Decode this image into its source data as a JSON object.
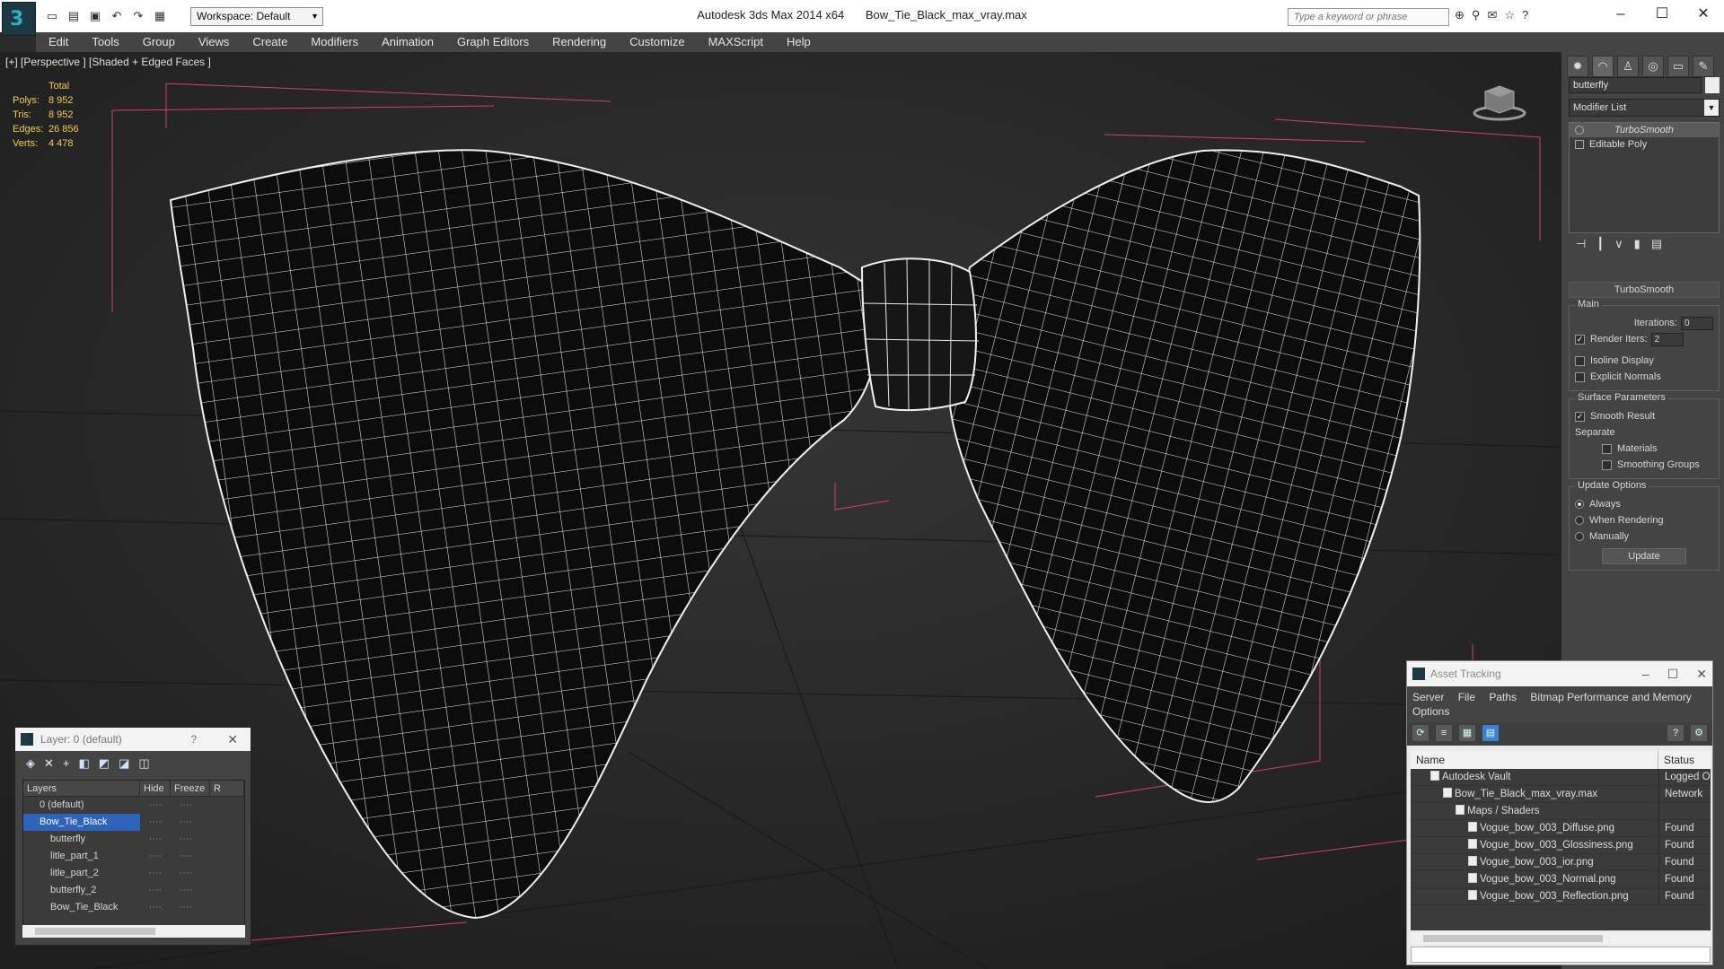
{
  "titlebar": {
    "app_name": "Autodesk 3ds Max  2014 x64",
    "file_name": "Bow_Tie_Black_max_vray.max",
    "workspace": "Workspace: Default",
    "search_placeholder": "Type a keyword or phrase"
  },
  "menu": [
    "Edit",
    "Tools",
    "Group",
    "Views",
    "Create",
    "Modifiers",
    "Animation",
    "Graph Editors",
    "Rendering",
    "Customize",
    "MAXScript",
    "Help"
  ],
  "viewport": {
    "label": "[+] [Perspective ] [Shaded + Edged Faces ]",
    "stats": {
      "header": "Total",
      "rows": [
        {
          "k": "Polys:",
          "v": "8 952"
        },
        {
          "k": "Tris:",
          "v": "8 952"
        },
        {
          "k": "Edges:",
          "v": "26 856"
        },
        {
          "k": "Verts:",
          "v": "4 478"
        }
      ]
    }
  },
  "command_panel": {
    "object_name": "butterfly",
    "modifier_list": "Modifier List",
    "stack": [
      "TurboSmooth",
      "Editable Poly"
    ],
    "rollout_title": "TurboSmooth",
    "main": {
      "label": "Main",
      "iterations_label": "Iterations:",
      "iterations": "0",
      "render_iters_label": "Render Iters:",
      "render_iters": "2",
      "isoline": "Isoline Display",
      "explicit": "Explicit Normals"
    },
    "surface": {
      "label": "Surface Parameters",
      "smooth_result": "Smooth Result",
      "separate": "Separate",
      "materials": "Materials",
      "smoothing_groups": "Smoothing Groups"
    },
    "update": {
      "label": "Update Options",
      "always": "Always",
      "when_rendering": "When Rendering",
      "manually": "Manually",
      "button": "Update"
    }
  },
  "layer_window": {
    "title": "Layer: 0 (default)",
    "help": "?",
    "columns": [
      "Layers",
      "Hide",
      "Freeze",
      "R"
    ],
    "rows": [
      {
        "name": "0 (default)",
        "indent": 18
      },
      {
        "name": "Bow_Tie_Black",
        "indent": 18
      },
      {
        "name": "butterfly",
        "indent": 30
      },
      {
        "name": "litle_part_1",
        "indent": 30
      },
      {
        "name": "litle_part_2",
        "indent": 30
      },
      {
        "name": "butterfly_2",
        "indent": 30
      },
      {
        "name": "Bow_Tie_Black",
        "indent": 30
      }
    ]
  },
  "asset_window": {
    "title": "Asset Tracking",
    "menu_line1": [
      "Server",
      "File",
      "Paths",
      "Bitmap Performance and Memory"
    ],
    "menu_line2": [
      "Options"
    ],
    "columns": {
      "name": "Name",
      "status": "Status"
    },
    "rows": [
      {
        "name": "Autodesk Vault",
        "status": "Logged O",
        "indent": 22
      },
      {
        "name": "Bow_Tie_Black_max_vray.max",
        "status": "Network",
        "indent": 36
      },
      {
        "name": "Maps / Shaders",
        "status": "",
        "indent": 50
      },
      {
        "name": "Vogue_bow_003_Diffuse.png",
        "status": "Found",
        "indent": 64
      },
      {
        "name": "Vogue_bow_003_Glossiness.png",
        "status": "Found",
        "indent": 64
      },
      {
        "name": "Vogue_bow_003_ior.png",
        "status": "Found",
        "indent": 64
      },
      {
        "name": "Vogue_bow_003_Normal.png",
        "status": "Found",
        "indent": 64
      },
      {
        "name": "Vogue_bow_003_Reflection.png",
        "status": "Found",
        "indent": 64
      }
    ]
  }
}
